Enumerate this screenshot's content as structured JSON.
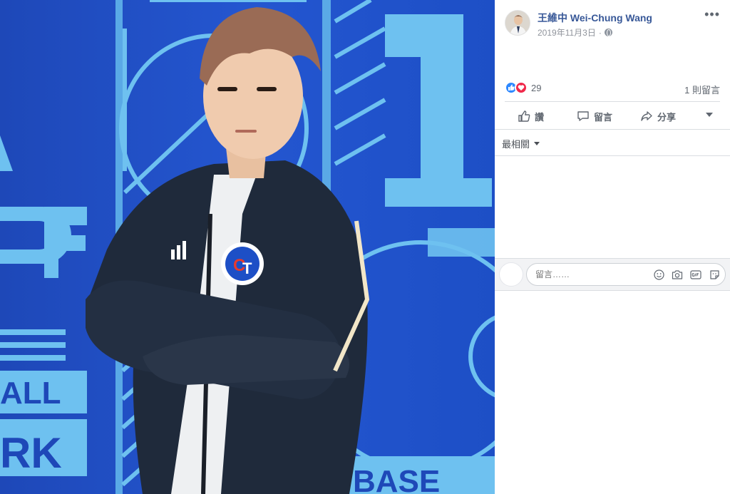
{
  "photo": {
    "description_icon": "photo",
    "accent": "#1f4fc4"
  },
  "post": {
    "author": "王維中 Wei-Chung Wang",
    "date": "2019年11月3日",
    "separator": "·",
    "privacy_icon": "globe-icon",
    "more_icon": "more-icon",
    "more_label": "•••"
  },
  "reactions": {
    "count": "29",
    "comments": "1 則留言"
  },
  "actions": {
    "like": "讚",
    "comment": "留言",
    "share": "分享"
  },
  "sort": {
    "label": "最相關"
  },
  "composer": {
    "placeholder": "留言……"
  },
  "colors": {
    "link": "#385898",
    "like": "#2d88ff",
    "love": "#f0284a"
  }
}
